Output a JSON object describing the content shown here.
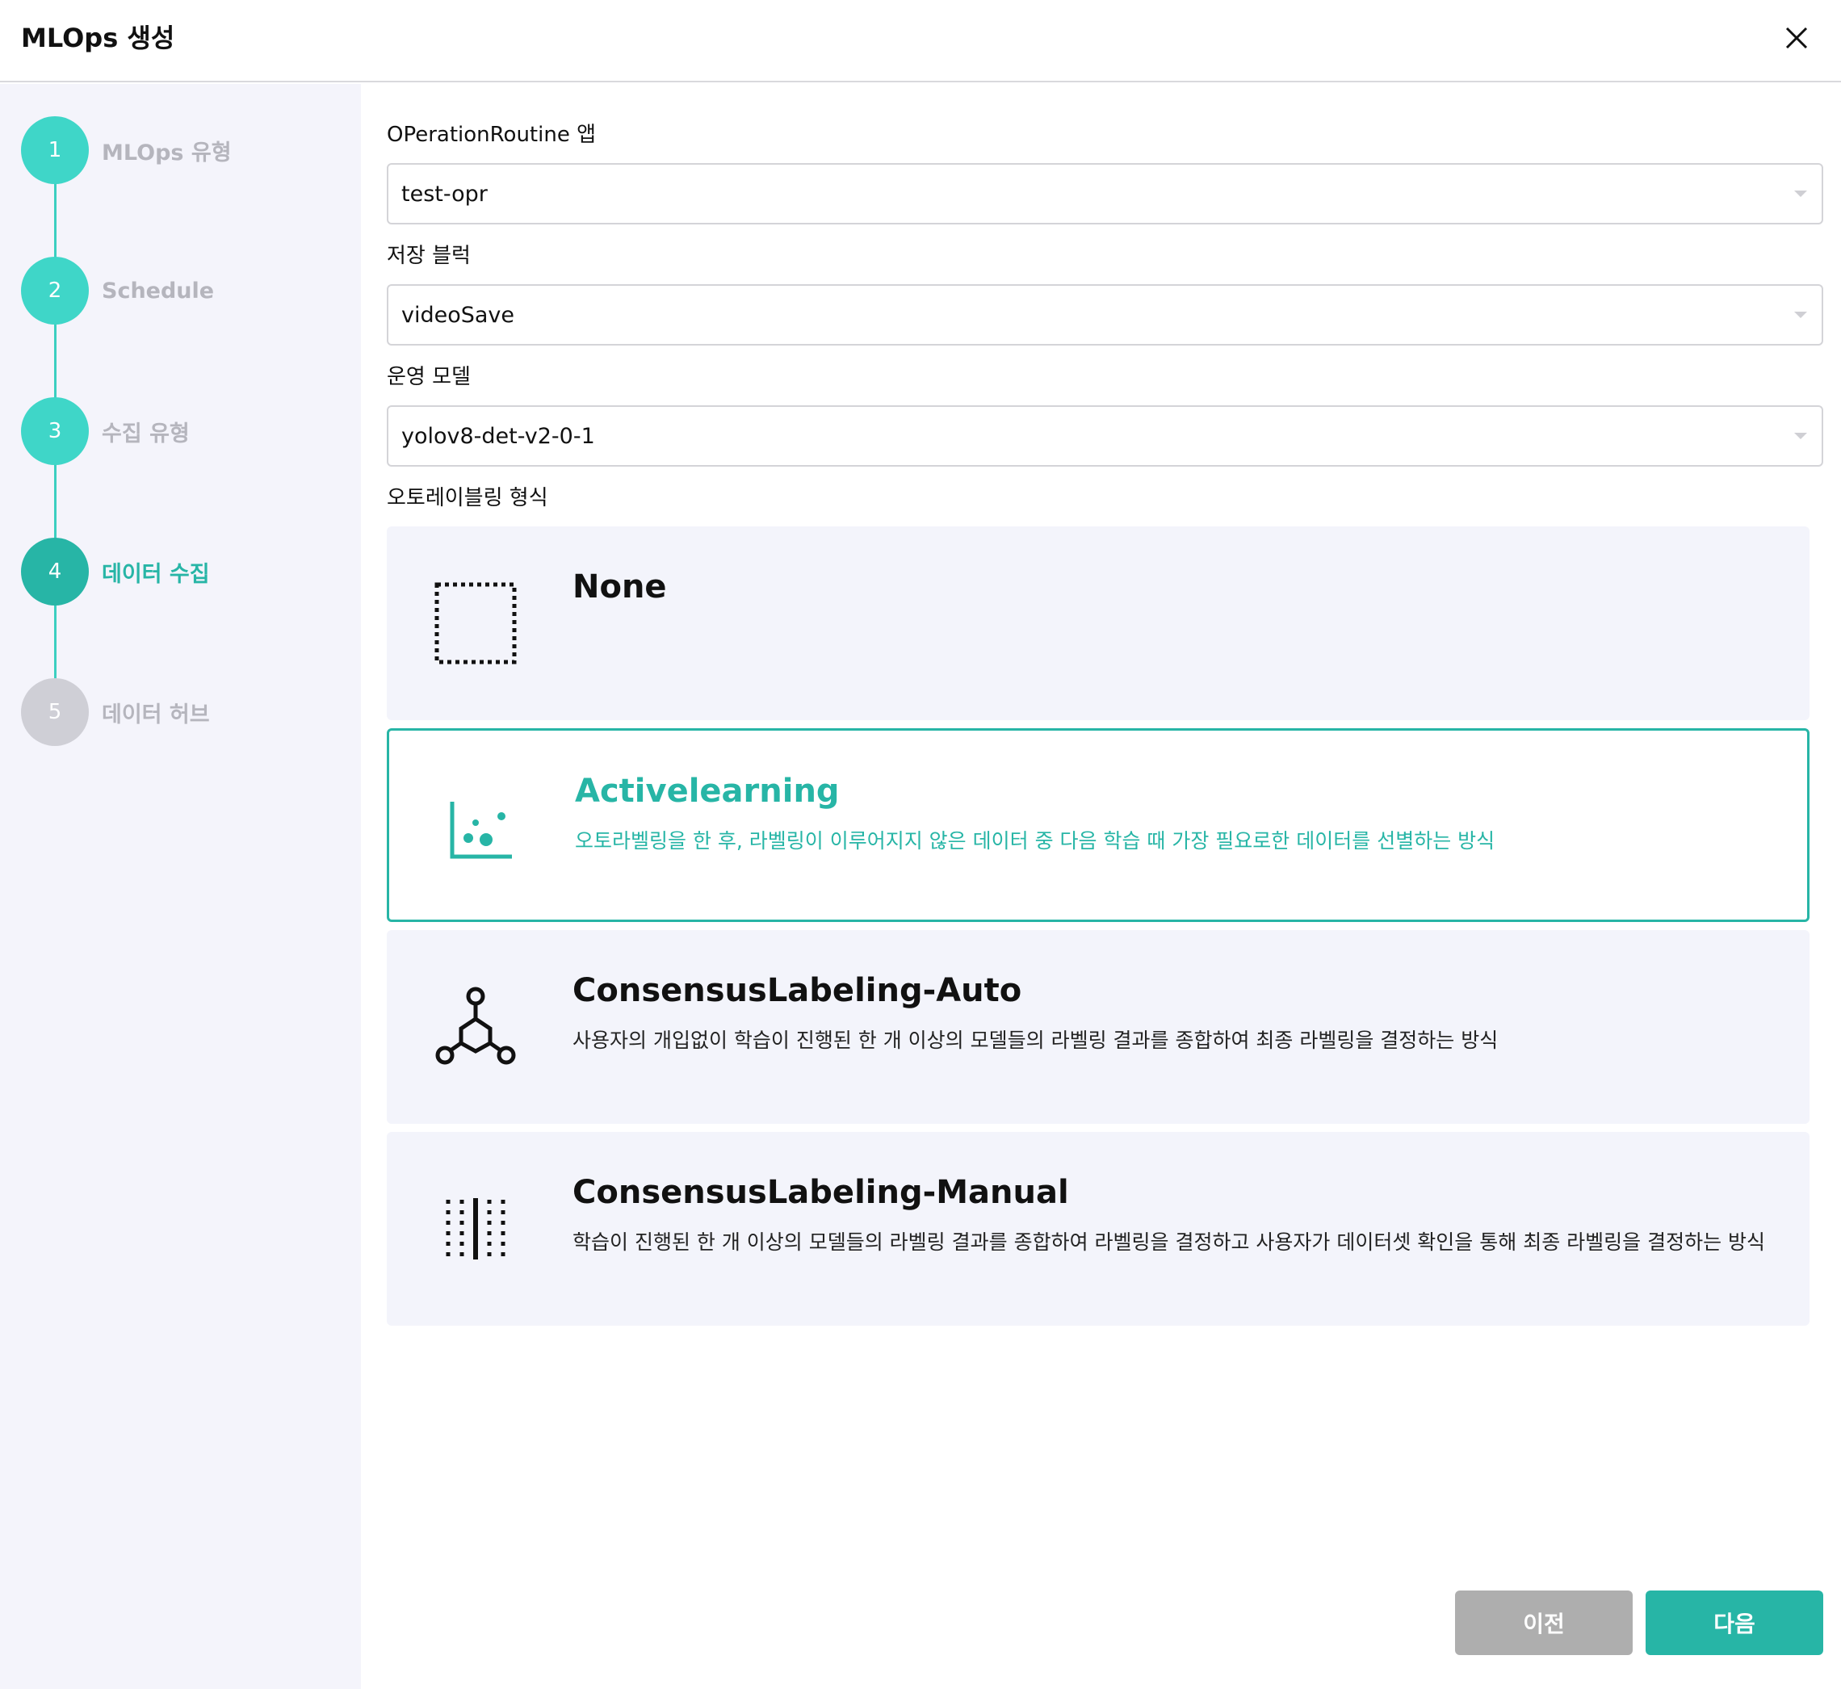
{
  "dialog": {
    "title": "MLOps 생성"
  },
  "steps": [
    {
      "number": "1",
      "label": "MLOps 유형",
      "state": "done"
    },
    {
      "number": "2",
      "label": "Schedule",
      "state": "done"
    },
    {
      "number": "3",
      "label": "수집 유형",
      "state": "done"
    },
    {
      "number": "4",
      "label": "데이터 수집",
      "state": "active"
    },
    {
      "number": "5",
      "label": "데이터 허브",
      "state": "pending"
    }
  ],
  "form": {
    "app": {
      "label": "OPerationRoutine 앱",
      "value": "test-opr"
    },
    "block": {
      "label": "저장 블럭",
      "value": "videoSave"
    },
    "model": {
      "label": "운영 모델",
      "value": "yolov8-det-v2-0-1"
    },
    "autolabel": {
      "label": "오토레이블링 형식",
      "options": [
        {
          "title": "None",
          "description": "",
          "icon": "dashed-square-icon",
          "selected": false
        },
        {
          "title": "Activelearning",
          "description": "오토라벨링을 한 후, 라벨링이 이루어지지 않은 데이터 중 다음 학습 때 가장 필요로한 데이터를 선별하는 방식",
          "icon": "scatter-plot-icon",
          "selected": true
        },
        {
          "title": "ConsensusLabeling-Auto",
          "description": "사용자의 개입없이 학습이 진행된 한 개 이상의 모델들의 라벨링 결과를 종합하여 최종 라벨링을 결정하는 방식",
          "icon": "hub-network-icon",
          "selected": false
        },
        {
          "title": "ConsensusLabeling-Manual",
          "description": "학습이 진행된 한 개 이상의 모델들의 라벨링 결과를 종합하여 라벨링을 결정하고 사용자가 데이터셋 확인을 통해 최종 라벨링을 결정하는 방식",
          "icon": "split-grid-icon",
          "selected": false
        }
      ]
    }
  },
  "buttons": {
    "prev": "이전",
    "next": "다음"
  },
  "colors": {
    "accent": "#27b5a6",
    "step_done": "#3fd6c8",
    "step_pending": "#cfcfd6",
    "prev_button": "#aeaeae"
  }
}
